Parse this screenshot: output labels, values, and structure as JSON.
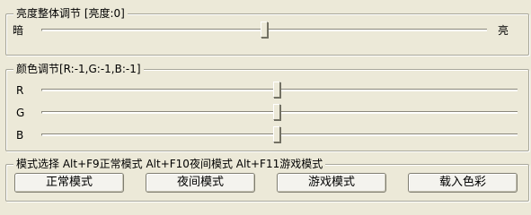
{
  "brightness": {
    "title": "亮度整体调节 [亮度:0]",
    "min_label": "暗",
    "max_label": "亮",
    "value": 0,
    "range": [
      -100,
      100
    ]
  },
  "color": {
    "title": "颜色调节[R:-1,G:-1,B:-1]",
    "channels": [
      {
        "label": "R",
        "value": -1,
        "range": [
          -100,
          100
        ]
      },
      {
        "label": "G",
        "value": -1,
        "range": [
          -100,
          100
        ]
      },
      {
        "label": "B",
        "value": -1,
        "range": [
          -100,
          100
        ]
      }
    ]
  },
  "mode": {
    "title": "模式选择 Alt+F9正常模式 Alt+F10夜间模式 Alt+F11游戏模式",
    "buttons": [
      "正常模式",
      "夜间模式",
      "游戏模式",
      "载入色彩"
    ]
  }
}
